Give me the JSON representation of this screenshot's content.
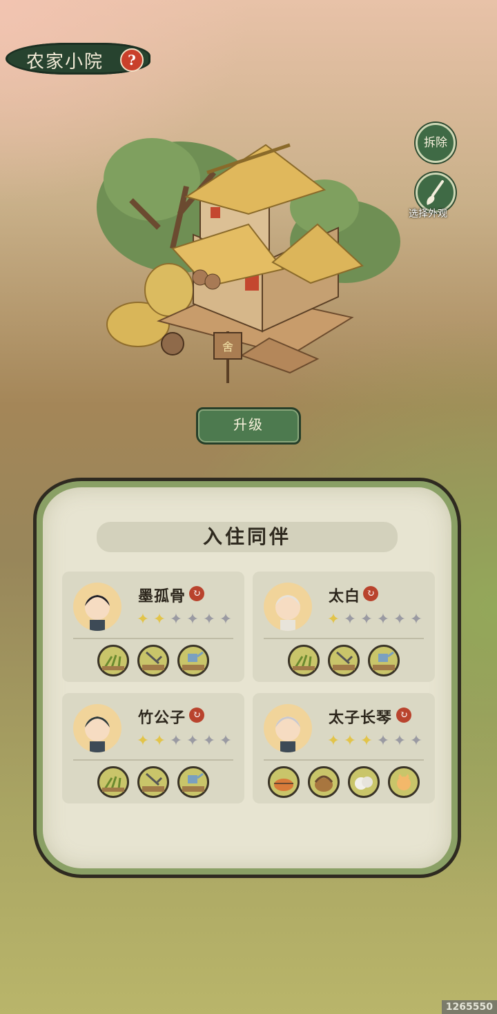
{
  "header": {
    "title": "农家小院",
    "help_glyph": "?"
  },
  "side_buttons": {
    "demolish_label": "拆除",
    "appearance_label": "选择外观"
  },
  "upgrade_label": "升级",
  "house_sign": "舍",
  "panel": {
    "title": "入住同伴",
    "companions": [
      {
        "name": "墨孤骨",
        "stars_filled": 2,
        "stars_total": 6,
        "skills": [
          "farming-icon",
          "hoe-icon",
          "watering-icon"
        ]
      },
      {
        "name": "太白",
        "stars_filled": 1,
        "stars_total": 6,
        "skills": [
          "farming-icon",
          "hoe-icon",
          "watering-icon"
        ]
      },
      {
        "name": "竹公子",
        "stars_filled": 2,
        "stars_total": 6,
        "skills": [
          "farming-icon",
          "hoe-icon",
          "watering-icon"
        ]
      },
      {
        "name": "太子长琴",
        "stars_filled": 3,
        "stars_total": 6,
        "skills": [
          "cooking-icon",
          "basket-icon",
          "wool-icon",
          "cat-icon"
        ]
      }
    ]
  },
  "watermark": "1265550",
  "colors": {
    "star_filled": "#e2c44a",
    "star_empty": "#9a9aa2",
    "button_green": "#4d7a4f",
    "accent_red": "#b9432d"
  }
}
